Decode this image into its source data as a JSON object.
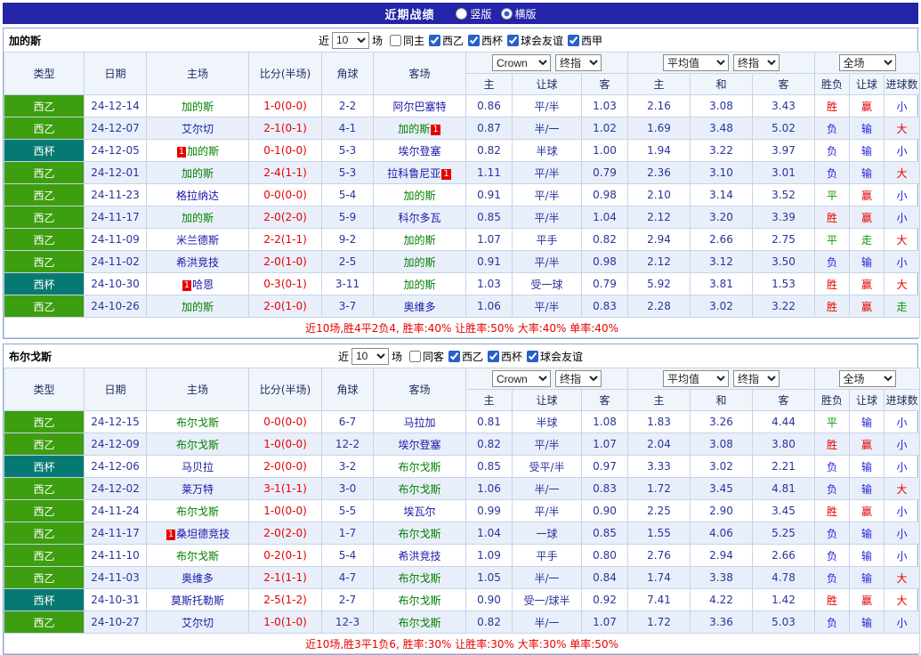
{
  "page": {
    "title": "近期战绩",
    "radios": [
      {
        "label": "竖版",
        "checked": false
      },
      {
        "label": "横版",
        "checked": true
      }
    ]
  },
  "filter_bar": {
    "near": "近",
    "count": "10",
    "games": "场"
  },
  "columns": {
    "type": "类型",
    "date": "日期",
    "home": "主场",
    "score": "比分(半场)",
    "corner": "角球",
    "away": "客场",
    "crow": "Crown",
    "final": "终指",
    "avg": "平均值",
    "full": "全场",
    "main": "主",
    "draw": "和",
    "away_odds": "客",
    "let": "让球",
    "wdl": "胜负",
    "goals": "进球数"
  },
  "colors": {
    "top_bar": "#2424a8",
    "league_green": "#3d9e0f",
    "league_teal": "#067a72",
    "win_red": "#e60000",
    "lose_blue": "#2222dd",
    "draw_green": "#089c00",
    "focal_team_green": "#008000",
    "team_blue": "#1818aa"
  },
  "tables": [
    {
      "team": "加的斯",
      "filters": [
        {
          "label": "同主",
          "checked": false
        },
        {
          "label": "西乙",
          "checked": true
        },
        {
          "label": "西杯",
          "checked": true
        },
        {
          "label": "球会友谊",
          "checked": true
        },
        {
          "label": "西甲",
          "checked": true
        }
      ],
      "rows": [
        {
          "league": "西乙",
          "date": "24-12-14",
          "home": "加的斯",
          "hf": true,
          "away": "阿尔巴塞特",
          "score": "1-0(0-0)",
          "corner": "2-2",
          "ah": [
            "0.86",
            "平/半",
            "1.03"
          ],
          "eu": [
            "2.16",
            "3.08",
            "3.43"
          ],
          "res": [
            "胜",
            "赢",
            "小"
          ]
        },
        {
          "league": "西乙",
          "date": "24-12-07",
          "home": "艾尔切",
          "away": "加的斯",
          "af": true,
          "ac": true,
          "score": "2-1(0-1)",
          "corner": "4-1",
          "ah": [
            "0.87",
            "半/一",
            "1.02"
          ],
          "eu": [
            "1.69",
            "3.48",
            "5.02"
          ],
          "res": [
            "负",
            "输",
            "大"
          ]
        },
        {
          "league": "西杯",
          "date": "24-12-05",
          "home": "加的斯",
          "hf": true,
          "hc": true,
          "away": "埃尔登塞",
          "score": "0-1(0-0)",
          "corner": "5-3",
          "ah": [
            "0.82",
            "半球",
            "1.00"
          ],
          "eu": [
            "1.94",
            "3.22",
            "3.97"
          ],
          "res": [
            "负",
            "输",
            "小"
          ]
        },
        {
          "league": "西乙",
          "date": "24-12-01",
          "home": "加的斯",
          "hf": true,
          "away": "拉科鲁尼亚",
          "ac": true,
          "score": "2-4(1-1)",
          "corner": "5-3",
          "ah": [
            "1.11",
            "平/半",
            "0.79"
          ],
          "eu": [
            "2.36",
            "3.10",
            "3.01"
          ],
          "res": [
            "负",
            "输",
            "大"
          ]
        },
        {
          "league": "西乙",
          "date": "24-11-23",
          "home": "格拉纳达",
          "away": "加的斯",
          "af": true,
          "score": "0-0(0-0)",
          "corner": "5-4",
          "ah": [
            "0.91",
            "平/半",
            "0.98"
          ],
          "eu": [
            "2.10",
            "3.14",
            "3.52"
          ],
          "res": [
            "平",
            "赢",
            "小"
          ]
        },
        {
          "league": "西乙",
          "date": "24-11-17",
          "home": "加的斯",
          "hf": true,
          "away": "科尔多瓦",
          "score": "2-0(2-0)",
          "corner": "5-9",
          "ah": [
            "0.85",
            "平/半",
            "1.04"
          ],
          "eu": [
            "2.12",
            "3.20",
            "3.39"
          ],
          "res": [
            "胜",
            "赢",
            "小"
          ]
        },
        {
          "league": "西乙",
          "date": "24-11-09",
          "home": "米兰德斯",
          "away": "加的斯",
          "af": true,
          "score": "2-2(1-1)",
          "corner": "9-2",
          "ah": [
            "1.07",
            "平手",
            "0.82"
          ],
          "eu": [
            "2.94",
            "2.66",
            "2.75"
          ],
          "res": [
            "平",
            "走",
            "大"
          ]
        },
        {
          "league": "西乙",
          "date": "24-11-02",
          "home": "希洪竞技",
          "away": "加的斯",
          "af": true,
          "score": "2-0(1-0)",
          "corner": "2-5",
          "ah": [
            "0.91",
            "平/半",
            "0.98"
          ],
          "eu": [
            "2.12",
            "3.12",
            "3.50"
          ],
          "res": [
            "负",
            "输",
            "小"
          ]
        },
        {
          "league": "西杯",
          "date": "24-10-30",
          "home": "哈恩",
          "hc": true,
          "away": "加的斯",
          "af": true,
          "score": "0-3(0-1)",
          "corner": "3-11",
          "ah": [
            "1.03",
            "受一球",
            "0.79"
          ],
          "eu": [
            "5.92",
            "3.81",
            "1.53"
          ],
          "res": [
            "胜",
            "赢",
            "大"
          ]
        },
        {
          "league": "西乙",
          "date": "24-10-26",
          "home": "加的斯",
          "hf": true,
          "away": "奥维多",
          "score": "2-0(1-0)",
          "corner": "3-7",
          "ah": [
            "1.06",
            "平/半",
            "0.83"
          ],
          "eu": [
            "2.28",
            "3.02",
            "3.22"
          ],
          "res": [
            "胜",
            "赢",
            "走"
          ]
        }
      ],
      "summary": "近10场,胜4平2负4, 胜率:40% 让胜率:50% 大率:40% 单率:40%"
    },
    {
      "team": "布尔戈斯",
      "filters": [
        {
          "label": "同客",
          "checked": false
        },
        {
          "label": "西乙",
          "checked": true
        },
        {
          "label": "西杯",
          "checked": true
        },
        {
          "label": "球会友谊",
          "checked": true
        }
      ],
      "rows": [
        {
          "league": "西乙",
          "date": "24-12-15",
          "home": "布尔戈斯",
          "hf": true,
          "away": "马拉加",
          "score": "0-0(0-0)",
          "corner": "6-7",
          "ah": [
            "0.81",
            "半球",
            "1.08"
          ],
          "eu": [
            "1.83",
            "3.26",
            "4.44"
          ],
          "res": [
            "平",
            "输",
            "小"
          ]
        },
        {
          "league": "西乙",
          "date": "24-12-09",
          "home": "布尔戈斯",
          "hf": true,
          "away": "埃尔登塞",
          "score": "1-0(0-0)",
          "corner": "12-2",
          "ah": [
            "0.82",
            "平/半",
            "1.07"
          ],
          "eu": [
            "2.04",
            "3.08",
            "3.80"
          ],
          "res": [
            "胜",
            "赢",
            "小"
          ]
        },
        {
          "league": "西杯",
          "date": "24-12-06",
          "home": "马贝拉",
          "away": "布尔戈斯",
          "af": true,
          "score": "2-0(0-0)",
          "corner": "3-2",
          "ah": [
            "0.85",
            "受平/半",
            "0.97"
          ],
          "eu": [
            "3.33",
            "3.02",
            "2.21"
          ],
          "res": [
            "负",
            "输",
            "小"
          ]
        },
        {
          "league": "西乙",
          "date": "24-12-02",
          "home": "莱万特",
          "away": "布尔戈斯",
          "af": true,
          "score": "3-1(1-1)",
          "corner": "3-0",
          "ah": [
            "1.06",
            "半/一",
            "0.83"
          ],
          "eu": [
            "1.72",
            "3.45",
            "4.81"
          ],
          "res": [
            "负",
            "输",
            "大"
          ]
        },
        {
          "league": "西乙",
          "date": "24-11-24",
          "home": "布尔戈斯",
          "hf": true,
          "away": "埃瓦尔",
          "score": "1-0(0-0)",
          "corner": "5-5",
          "ah": [
            "0.99",
            "平/半",
            "0.90"
          ],
          "eu": [
            "2.25",
            "2.90",
            "3.45"
          ],
          "res": [
            "胜",
            "赢",
            "小"
          ]
        },
        {
          "league": "西乙",
          "date": "24-11-17",
          "home": "桑坦德竞技",
          "hc": true,
          "away": "布尔戈斯",
          "af": true,
          "score": "2-0(2-0)",
          "corner": "1-7",
          "ah": [
            "1.04",
            "一球",
            "0.85"
          ],
          "eu": [
            "1.55",
            "4.06",
            "5.25"
          ],
          "res": [
            "负",
            "输",
            "小"
          ]
        },
        {
          "league": "西乙",
          "date": "24-11-10",
          "home": "布尔戈斯",
          "hf": true,
          "away": "希洪竞技",
          "score": "0-2(0-1)",
          "corner": "5-4",
          "ah": [
            "1.09",
            "平手",
            "0.80"
          ],
          "eu": [
            "2.76",
            "2.94",
            "2.66"
          ],
          "res": [
            "负",
            "输",
            "小"
          ]
        },
        {
          "league": "西乙",
          "date": "24-11-03",
          "home": "奥维多",
          "away": "布尔戈斯",
          "af": true,
          "score": "2-1(1-1)",
          "corner": "4-7",
          "ah": [
            "1.05",
            "半/一",
            "0.84"
          ],
          "eu": [
            "1.74",
            "3.38",
            "4.78"
          ],
          "res": [
            "负",
            "输",
            "大"
          ]
        },
        {
          "league": "西杯",
          "date": "24-10-31",
          "home": "莫斯托勒斯",
          "away": "布尔戈斯",
          "af": true,
          "score": "2-5(1-2)",
          "corner": "2-7",
          "ah": [
            "0.90",
            "受一/球半",
            "0.92"
          ],
          "eu": [
            "7.41",
            "4.22",
            "1.42"
          ],
          "res": [
            "胜",
            "赢",
            "大"
          ]
        },
        {
          "league": "西乙",
          "date": "24-10-27",
          "home": "艾尔切",
          "away": "布尔戈斯",
          "af": true,
          "score": "1-0(1-0)",
          "corner": "12-3",
          "ah": [
            "0.82",
            "半/一",
            "1.07"
          ],
          "eu": [
            "1.72",
            "3.36",
            "5.03"
          ],
          "res": [
            "负",
            "输",
            "小"
          ]
        }
      ],
      "summary": "近10场,胜3平1负6, 胜率:30% 让胜率:30% 大率:30% 单率:50%"
    }
  ]
}
